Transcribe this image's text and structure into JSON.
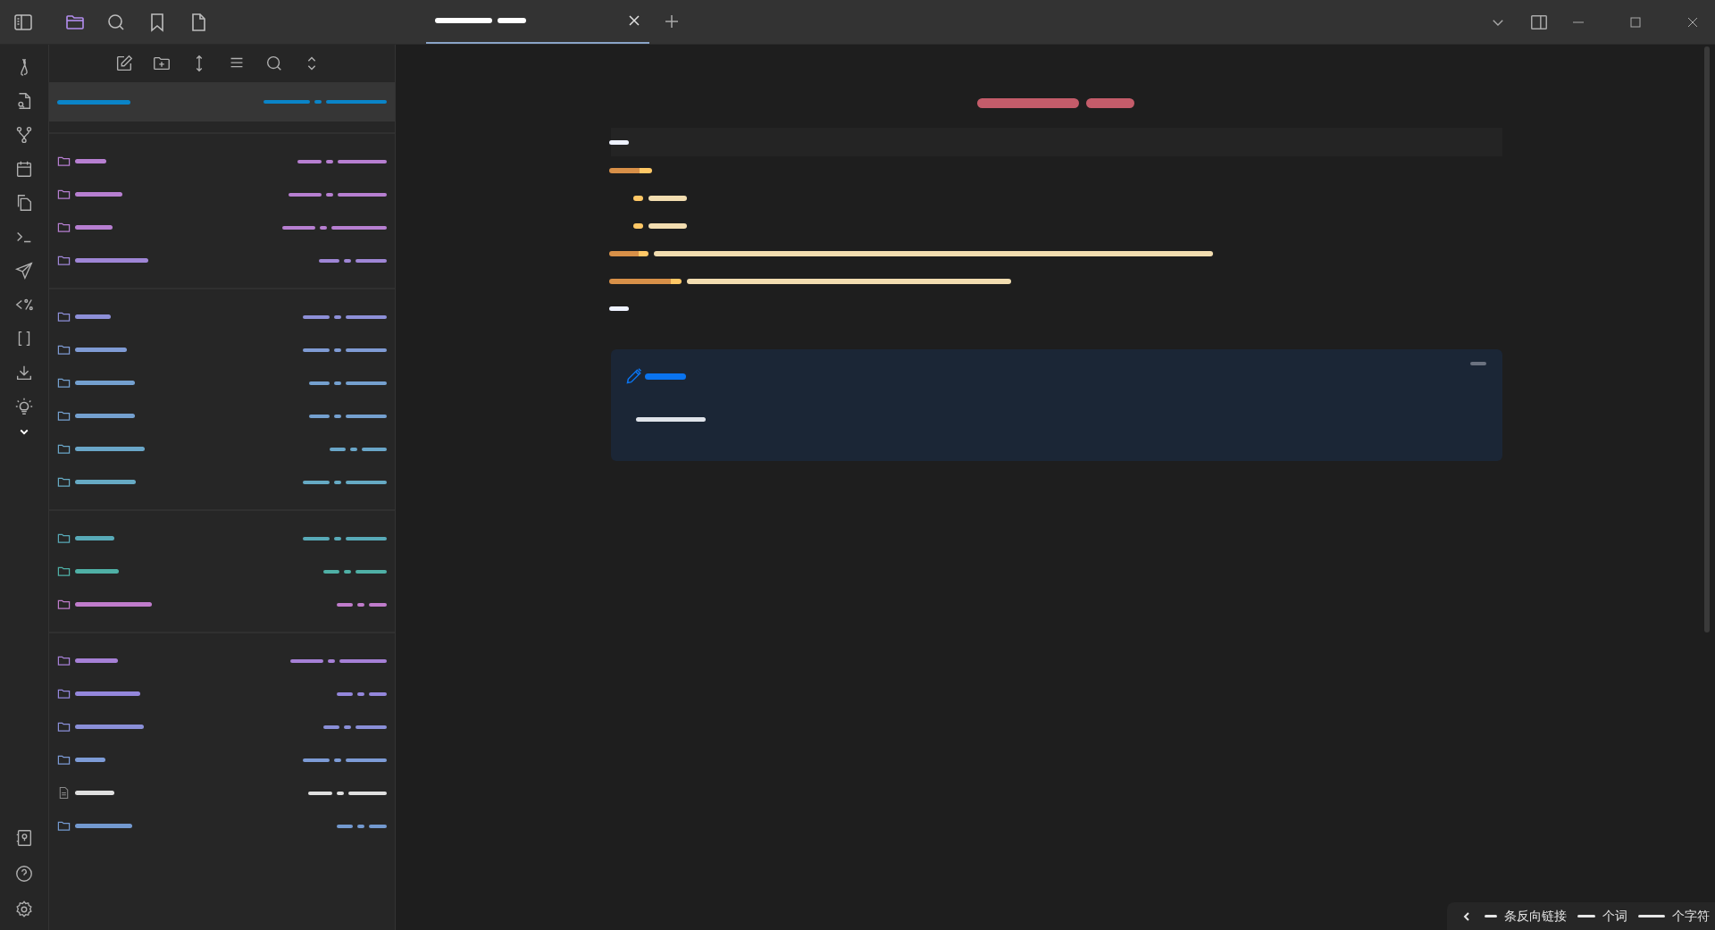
{
  "titlebar": {
    "tabs": [
      {
        "selected": true
      }
    ]
  },
  "ribbon": {
    "items": [
      {
        "kind": "link"
      },
      {
        "kind": "filesearch"
      },
      {
        "kind": "graph"
      },
      {
        "kind": "calendar"
      },
      {
        "kind": "copy"
      },
      {
        "kind": "terminal"
      },
      {
        "kind": "send"
      },
      {
        "kind": "template"
      },
      {
        "kind": "brackets"
      },
      {
        "kind": "download"
      },
      {
        "kind": "bulb"
      },
      {
        "kind": "chevron"
      }
    ]
  },
  "explorer": {
    "groups": [
      {
        "items": [
          {
            "kind": "note",
            "color": "#0a84c8",
            "selected": true
          }
        ]
      },
      {
        "items": [
          {
            "kind": "folder",
            "color": "#b77fd1",
            "selected": false
          },
          {
            "kind": "folder",
            "color": "#b77fd1",
            "selected": false
          },
          {
            "kind": "folder",
            "color": "#b77fd1",
            "selected": false
          },
          {
            "kind": "folder",
            "color": "#9f86d6",
            "selected": false
          }
        ]
      },
      {
        "items": [
          {
            "kind": "folder",
            "color": "#8d8fd8",
            "selected": false
          },
          {
            "kind": "folder",
            "color": "#7f9bd4",
            "selected": false
          },
          {
            "kind": "folder",
            "color": "#74a0cf",
            "selected": false
          },
          {
            "kind": "folder",
            "color": "#74a0cf",
            "selected": false
          },
          {
            "kind": "folder",
            "color": "#6aa6c8",
            "selected": false
          },
          {
            "kind": "folder",
            "color": "#66aac4",
            "selected": false
          }
        ]
      },
      {
        "items": [
          {
            "kind": "folder",
            "color": "#58aab8",
            "selected": false
          },
          {
            "kind": "folder",
            "color": "#4fb0a6",
            "selected": false
          },
          {
            "kind": "folder",
            "color": "#c07ccc",
            "selected": false
          }
        ]
      },
      {
        "items": [
          {
            "kind": "folder",
            "color": "#a680d6",
            "selected": false
          },
          {
            "kind": "folder",
            "color": "#9487dc",
            "selected": false
          },
          {
            "kind": "folder",
            "color": "#8a8fd8",
            "selected": false
          },
          {
            "kind": "folder",
            "color": "#7d9bd6",
            "selected": false
          },
          {
            "kind": "file",
            "color": "#e0e0e0",
            "selected": false
          },
          {
            "kind": "folder",
            "color": "#7399cf",
            "selected": false
          }
        ]
      }
    ]
  },
  "status_bar": {
    "labels": [
      "条反向链接",
      "个词",
      "个字符"
    ]
  }
}
